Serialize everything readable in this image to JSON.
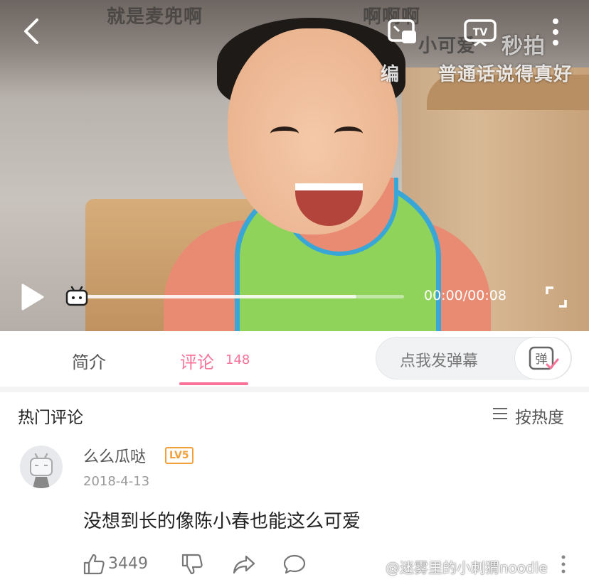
{
  "video": {
    "subtitle_top_left": "就是麦兜啊",
    "subtitle_top_mid": "啊啊啊",
    "subtitle_cute": "小可爱",
    "subtitle_right": "普通话说得真好",
    "subtitle_edge": "编",
    "source_watermark": "秒拍",
    "time": "00:00/00:08",
    "progress": 0,
    "buffered": 0.85
  },
  "tabs": {
    "intro_label": "简介",
    "comments_label": "评论",
    "comments_count": "148",
    "danmaku_placeholder": "点我发弹幕",
    "danmaku_icon_char": "弹"
  },
  "comments": {
    "section_title": "热门评论",
    "sort_label": "按热度",
    "items": [
      {
        "username": "么么瓜哒",
        "level": "LV5",
        "date": "2018-4-13",
        "text": "没想到长的像陈小春也能这么可爱",
        "likes": "3449"
      }
    ]
  },
  "watermark": "@迷雾里的小刺猬noodle",
  "colors": {
    "accent": "#fb7299",
    "level": "#f2a03a"
  }
}
